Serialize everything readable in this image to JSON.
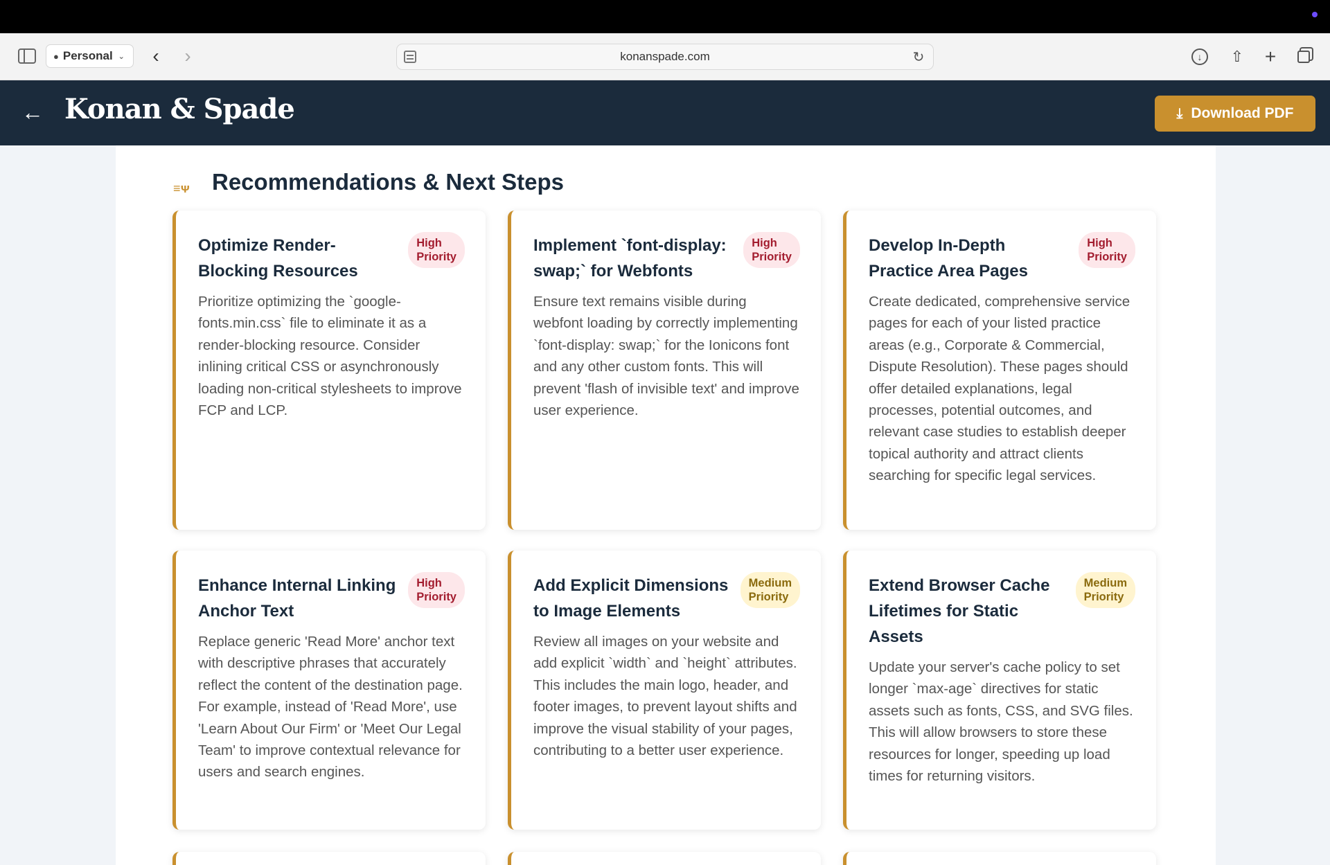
{
  "browser": {
    "profile_label": "Personal",
    "url": "konanspade.com"
  },
  "header": {
    "logo": "Konan & Spade",
    "download_label": "Download PDF"
  },
  "section": {
    "title": "Recommendations & Next Steps"
  },
  "cards": [
    {
      "title": "Optimize Render-Blocking Resources",
      "priority": "High Priority",
      "level": "high",
      "description": "Prioritize optimizing the `google-fonts.min.css` file to eliminate it as a render-blocking resource. Consider inlining critical CSS or asynchronously loading non-critical stylesheets to improve FCP and LCP."
    },
    {
      "title": "Implement `font-display: swap;` for Webfonts",
      "priority": "High Priority",
      "level": "high",
      "description": "Ensure text remains visible during webfont loading by correctly implementing `font-display: swap;` for the Ionicons font and any other custom fonts. This will prevent 'flash of invisible text' and improve user experience."
    },
    {
      "title": "Develop In-Depth Practice Area Pages",
      "priority": "High Priority",
      "level": "high",
      "description": "Create dedicated, comprehensive service pages for each of your listed practice areas (e.g., Corporate & Commercial, Dispute Resolution). These pages should offer detailed explanations, legal processes, potential outcomes, and relevant case studies to establish deeper topical authority and attract clients searching for specific legal services."
    },
    {
      "title": "Enhance Internal Linking Anchor Text",
      "priority": "High Priority",
      "level": "high",
      "description": "Replace generic 'Read More' anchor text with descriptive phrases that accurately reflect the content of the destination page. For example, instead of 'Read More', use 'Learn About Our Firm' or 'Meet Our Legal Team' to improve contextual relevance for users and search engines."
    },
    {
      "title": "Add Explicit Dimensions to Image Elements",
      "priority": "Medium Priority",
      "level": "medium",
      "description": "Review all images on your website and add explicit `width` and `height` attributes. This includes the main logo, header, and footer images, to prevent layout shifts and improve the visual stability of your pages, contributing to a better user experience."
    },
    {
      "title": "Extend Browser Cache Lifetimes for Static Assets",
      "priority": "Medium Priority",
      "level": "medium",
      "description": "Update your server's cache policy to set longer `max-age` directives for static assets such as fonts, CSS, and SVG files. This will allow browsers to store these resources for longer, speeding up load times for returning visitors."
    }
  ],
  "icons": {
    "sidebar": "sidebar-toggle-icon",
    "person": "person-icon",
    "back": "chevron-left-icon",
    "forward": "chevron-right-icon",
    "page": "page-menu-icon",
    "reload": "reload-icon",
    "download": "download-icon",
    "share": "share-icon",
    "new_tab": "plus-icon",
    "tabs": "tab-overview-icon",
    "app_back": "arrow-left-icon",
    "section": "tools-icon"
  },
  "colors": {
    "header_bg": "#1b2b3c",
    "accent": "#c9902e",
    "high_badge_bg": "#fde7ea",
    "high_badge_text": "#a31d2f",
    "medium_badge_bg": "#fff4cf",
    "medium_badge_text": "#8a6a0d"
  }
}
